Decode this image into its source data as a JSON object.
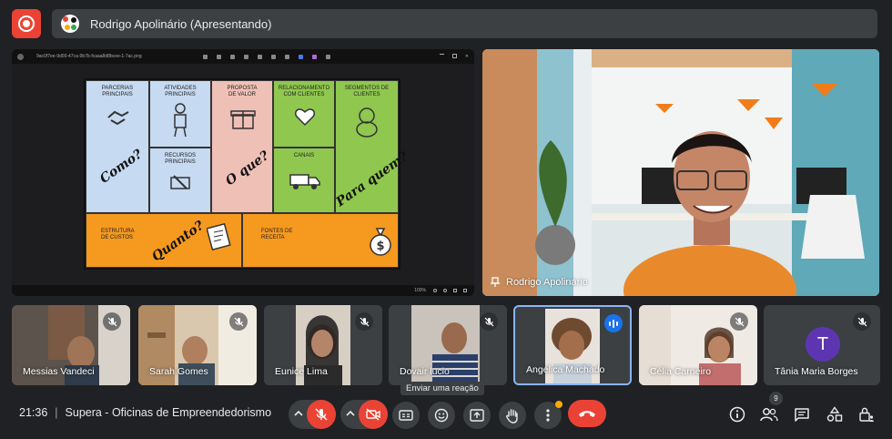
{
  "header": {
    "presenter_title": "Rodrigo Apolinário (Apresentando)"
  },
  "share": {
    "file_name": "9ac0f7ee-9d00-47ca-9b7b-fcaaa8d8bcee-1-7ac.png",
    "zoom": "100%",
    "canvas": {
      "parcerias": "PARCERIAS\nPRINCIPAIS",
      "atividades": "ATIVIDADES\nPRINCIPAIS",
      "recursos": "RECURSOS\nPRINCIPAIS",
      "proposta": "PROPOSTA\nDE VALOR",
      "relacionamento": "RELACIONAMENTO\nCOM CLIENTES",
      "canais": "CANAIS",
      "segmentos": "SEGMENTOS DE\nCLIENTES",
      "estrutura": "ESTRUTURA\nDE CUSTOS",
      "fontes": "FONTES DE\nRECEITA",
      "como": "Como?",
      "oque": "O que?",
      "paraquem": "Para quem?",
      "quanto": "Quanto?"
    }
  },
  "camera": {
    "name": "Rodrigo Apolinário"
  },
  "participants": [
    {
      "name": "Messias Vandeci"
    },
    {
      "name": "Sarah Gomes"
    },
    {
      "name": "Eunice Lima"
    },
    {
      "name": "Dovair lucio"
    },
    {
      "name": "Angélica Machado"
    },
    {
      "name": "Célia Carneiro"
    },
    {
      "name": "Tânia Maria Borges",
      "initial": "T"
    }
  ],
  "tooltip": "Enviar uma reação",
  "bottom": {
    "time": "21:36",
    "separator": "|",
    "meeting_name": "Supera - Oficinas de Empreendedorismo",
    "people_count": "9"
  },
  "colors": {
    "background": "#202124",
    "surface": "#3c4043",
    "danger": "#ea4335",
    "accent": "#8ab4f8",
    "avatar_t": "#5e35b1"
  }
}
